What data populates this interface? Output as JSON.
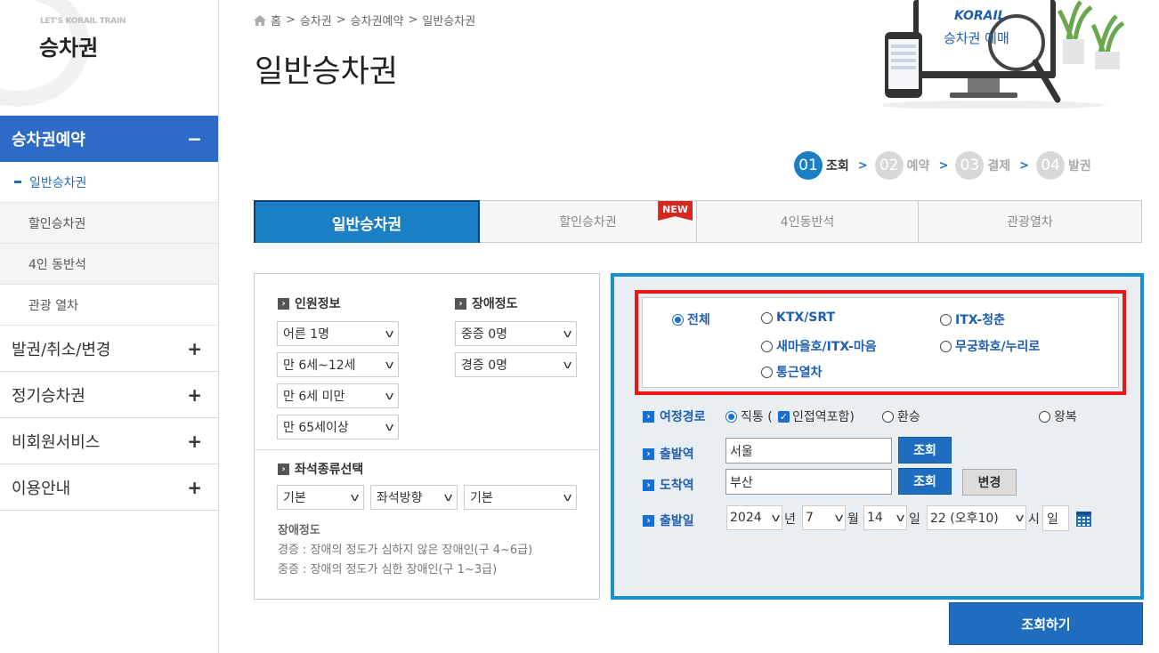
{
  "brand": {
    "small": "LET'S KORAIL TRAIN",
    "big": "승차권"
  },
  "sidebar": {
    "main1": "승차권예약",
    "main1_sign": "−",
    "sub": [
      "일반승차권",
      "할인승차권",
      "4인 동반석",
      "관광 열차"
    ],
    "others": [
      {
        "label": "발권/취소/변경",
        "sign": "+"
      },
      {
        "label": "정기승차권",
        "sign": "+"
      },
      {
        "label": "비회원서비스",
        "sign": "+"
      },
      {
        "label": "이용안내",
        "sign": "+"
      }
    ]
  },
  "breadcrumb": [
    "홈",
    "승차권",
    "승차권예약",
    "일반승차권"
  ],
  "page_title": "일반승차권",
  "hero": {
    "logo": "KORAIL",
    "caption": "승차권 예매"
  },
  "steps": [
    {
      "num": "01",
      "label": "조회"
    },
    {
      "num": "02",
      "label": "예약"
    },
    {
      "num": "03",
      "label": "결제"
    },
    {
      "num": "04",
      "label": "발권"
    }
  ],
  "tabs": [
    "일반승차권",
    "할인승차권",
    "4인동반석",
    "관광열차"
  ],
  "new_badge": "NEW",
  "passenger": {
    "title": "인원정보",
    "selects": [
      "어른 1명",
      "만 6세~12세",
      "만 6세 미만",
      "만 65세이상"
    ]
  },
  "disability": {
    "title": "장애정도",
    "selects": [
      "중증 0명",
      "경증 0명"
    ]
  },
  "seat": {
    "title": "좌석종류선택",
    "selects": [
      "기본",
      "좌석방향",
      "기본"
    ]
  },
  "notes": {
    "title": "장애정도",
    "line1": "경증 : 장애의 정도가 심하지 않은 장애인(구 4~6급)",
    "line2": "중증 : 장애의 정도가 심한 장애인(구 1~3급)"
  },
  "train_types": [
    "전체",
    "KTX/SRT",
    "ITX-청춘",
    "새마을호/ITX-마음",
    "무궁화호/누리로",
    "통근열차"
  ],
  "route": {
    "label": "여정경로",
    "direct": "직통 (",
    "nearby": "인접역포함)",
    "transfer": "환승",
    "roundtrip": "왕복"
  },
  "departure": {
    "label": "출발역",
    "value": "서울",
    "button": "조회"
  },
  "arrival": {
    "label": "도착역",
    "value": "부산",
    "button": "조회",
    "swap": "변경"
  },
  "date": {
    "label": "출발일",
    "year": "2024",
    "year_unit": "년",
    "month": "7",
    "month_unit": "월",
    "day": "14",
    "day_unit": "일",
    "hour": "22 (오후10)",
    "hour_unit": "시",
    "weekday": "일"
  },
  "search_button": "조회하기",
  "colors": {
    "accent": "#1f6dbf",
    "tab_active": "#1a7fc4",
    "highlight": "#ee1515"
  }
}
